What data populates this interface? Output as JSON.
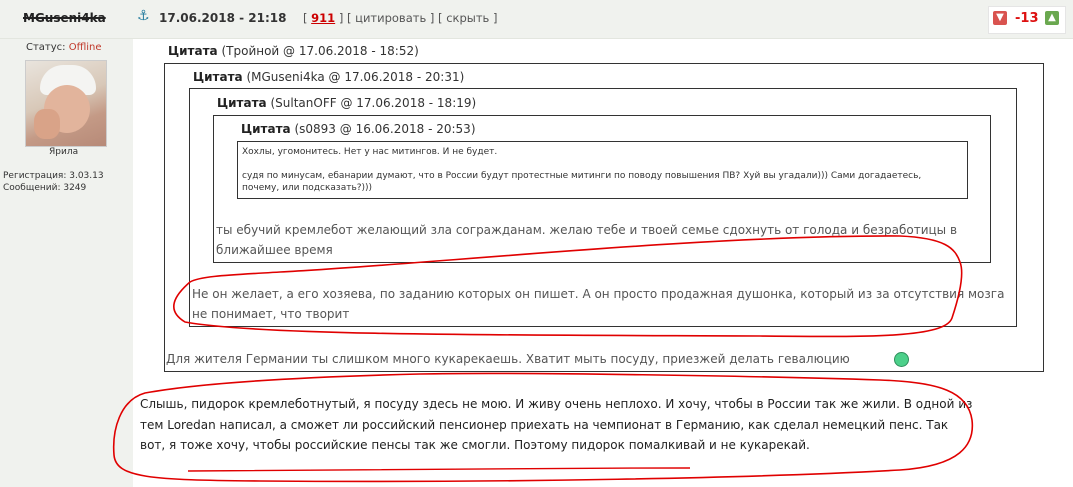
{
  "post": {
    "username": "MGuseni4ka",
    "anchor_icon": "anchor-icon",
    "date": "17.06.2018 - 21:18",
    "links": {
      "open": "[ ",
      "number": "911",
      "sep1": " ] [ ",
      "quote": "цитировать",
      "sep2": " ] [ ",
      "hide": "скрыть",
      "close": " ]"
    },
    "rating": {
      "score": "-13",
      "down_icon": "thumb-down-icon",
      "up_icon": "thumb-up-icon"
    }
  },
  "sidebar": {
    "status_label": "Статус: ",
    "status_value": "Offline",
    "rank": "Ярила",
    "registration": "Регистрация: 3.03.13",
    "messages": "Сообщений: 3249"
  },
  "quotes": [
    {
      "label": "Цитата",
      "meta": " (Тройной @ 17.06.2018 - 18:52)",
      "text": "Для жителя Германии ты слишком много кукарекаешь. Хватит мыть посуду, приезжей делать гевалюцию"
    },
    {
      "label": "Цитата",
      "meta": " (MGuseni4ka @ 17.06.2018 - 20:31)",
      "text": "Не он желает, а его хозяева, по заданию которых он пишет. А он просто продажная душонка, который из за отсутствия мозга не понимает, что творит"
    },
    {
      "label": "Цитата",
      "meta": " (SultanOFF @ 17.06.2018 - 18:19)",
      "text": "ты ебучий кремлебот желающий зла согражданам. желаю тебе и твоей семье сдохнуть от голода и безработицы в ближайшее время"
    },
    {
      "label": "Цитата",
      "meta": " (s0893 @ 16.06.2018 - 20:53)",
      "line1": "Хохлы, угомонитесь. Нет у нас митингов. И не будет.",
      "line2": "судя по минусам, ебанарии думают, что в России будут протестные митинги по поводу повышения ПВ? Хуй вы угадали))) Сами догадаетесь, почему, или подсказать?)))"
    }
  ],
  "reply": "Слышь, пидорок кремлеботнутый, я посуду здесь не мою. И живу очень неплохо. И хочу, чтобы в России так же жили. В одной из тем Loredan написал, а сможет ли российский пенсионер приехать на чемпионат в Германию, как сделал немецкий пенс. Так вот, я тоже хочу, чтобы российские пенсы так же смогли. Поэтому пидорок помалкивай и не кукарекай.",
  "colors": {
    "header_bg": "#f0f2ee",
    "score": "#d11111",
    "annotation": "#e00000",
    "emoji": "#4cd08a"
  }
}
